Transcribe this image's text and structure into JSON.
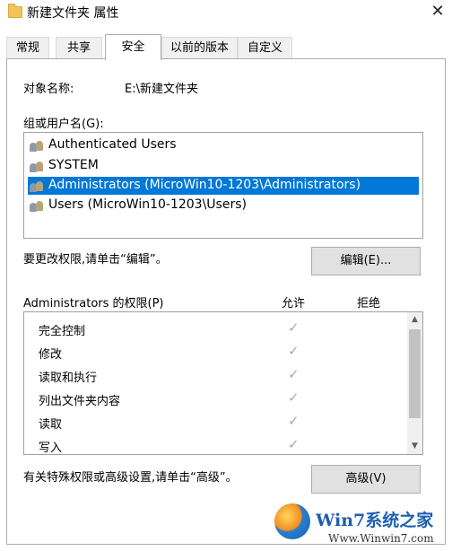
{
  "window": {
    "title": "新建文件夹 属性",
    "close_glyph": "✕"
  },
  "tabs": [
    {
      "label": "常规",
      "active": false
    },
    {
      "label": "共享",
      "active": false
    },
    {
      "label": "安全",
      "active": true
    },
    {
      "label": "以前的版本",
      "active": false
    },
    {
      "label": "自定义",
      "active": false
    }
  ],
  "object": {
    "label": "对象名称:",
    "value": "E:\\新建文件夹"
  },
  "groups": {
    "label": "组或用户名(G):",
    "items": [
      {
        "name": "Authenticated Users",
        "selected": false
      },
      {
        "name": "SYSTEM",
        "selected": false
      },
      {
        "name": "Administrators (MicroWin10-1203\\Administrators)",
        "selected": true
      },
      {
        "name": "Users (MicroWin10-1203\\Users)",
        "selected": false
      }
    ]
  },
  "edit": {
    "hint": "要更改权限,请单击“编辑”。",
    "button": "编辑(E)..."
  },
  "permissions": {
    "header": "Administrators 的权限(P)",
    "allow": "允许",
    "deny": "拒绝",
    "rows": [
      {
        "name": "完全控制",
        "check": "✓"
      },
      {
        "name": "修改",
        "check": "✓"
      },
      {
        "name": "读取和执行",
        "check": "✓"
      },
      {
        "name": "列出文件夹内容",
        "check": "✓"
      },
      {
        "name": "读取",
        "check": "✓"
      },
      {
        "name": "写入",
        "check": "✓"
      }
    ],
    "scroll_up": "▲",
    "scroll_down": "▼"
  },
  "advanced": {
    "hint": "有关特殊权限或高级设置,请单击“高级”。",
    "button": "高级(V)"
  },
  "watermark": {
    "brand": "Win7系统之家",
    "url": "Www.Winwin7.com"
  },
  "colors": {
    "selection": "#0078d7",
    "check": "#a8a8a8"
  }
}
